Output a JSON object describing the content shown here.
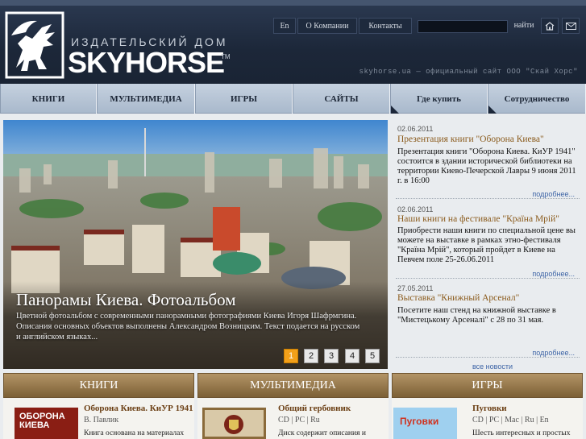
{
  "header": {
    "logo_sub": "ИЗДАТЕЛЬСКИЙ ДОМ",
    "logo_name": "SKYHORSE",
    "logo_tm": "TM",
    "nav": [
      "En",
      "О Компании",
      "Контакты"
    ],
    "search_value": "",
    "search_button": "найти",
    "tagline": "skyhorse.ua — официальный сайт ООО \"Скай Хорс\""
  },
  "main_nav": [
    "КНИГИ",
    "МУЛЬТИМЕДИА",
    "ИГРЫ",
    "САЙТЫ",
    "Где купить",
    "Сотрудничество"
  ],
  "slider": {
    "title": "Панорамы Киева. Фотоальбом",
    "description": "Цветной фотоальбом с современными панорамными фотографиями Киева Игоря Шафрмгина. Описания основных объектов выполнены Александром Возницким. Текст подается на русском и английском языках...",
    "pages": [
      "1",
      "2",
      "3",
      "4",
      "5"
    ],
    "active_page": "1"
  },
  "news": [
    {
      "date": "02.06.2011",
      "title": "Презентация книги \"Оборона Киева\"",
      "text": "Презентация книги \"Оборона Киева. КиУР 1941\" состоится в здании исторической библиотеки на территории Киево-Печерской Лавры 9 июня 2011 г. в 16:00",
      "more": "подробнее..."
    },
    {
      "date": "02.06.2011",
      "title": "Наши книги на фестивале \"Країна Мрій\"",
      "text": "Приобрести наши книги по специальной цене вы можете на выставке в рамках этно-фестиваля \"Країна Мрій\", который пройдет в Киеве на Певчем поле 25-26.06.2011",
      "more": "подробнее..."
    },
    {
      "date": "27.05.2011",
      "title": "Выставка \"Книжный Арсенал\"",
      "text": "Посетите наш стенд на книжной выставке в \"Мистецькому Арсеналі\" с 28 по 31 мая.",
      "more": "подробнее..."
    }
  ],
  "all_news": "все новости",
  "sections": [
    {
      "heading": "КНИГИ",
      "title": "Оборона Киева. КиУР 1941",
      "meta": "В. Павлик",
      "desc": "Книга основана на материалах",
      "cover_text": "ОБОРОНА КИЕВА"
    },
    {
      "heading": "МУЛЬТИМЕДИА",
      "title": "Общий гербовник",
      "meta": "CD | PC | Ru",
      "desc": "Диск содержит описания и"
    },
    {
      "heading": "ИГРЫ",
      "title": "Пуговки",
      "meta": "CD | PC | Mac | Ru | En",
      "desc": "Шесть интересных и простых",
      "cover_text": "Пуговки"
    }
  ],
  "colors": {
    "header_bg": "#1c2739",
    "nav_bg": "#b7c5d6",
    "section_bar": "#8f7244",
    "news_title": "#8a5a1b",
    "pager_active": "#f2a01a",
    "link": "#3d64a6"
  }
}
